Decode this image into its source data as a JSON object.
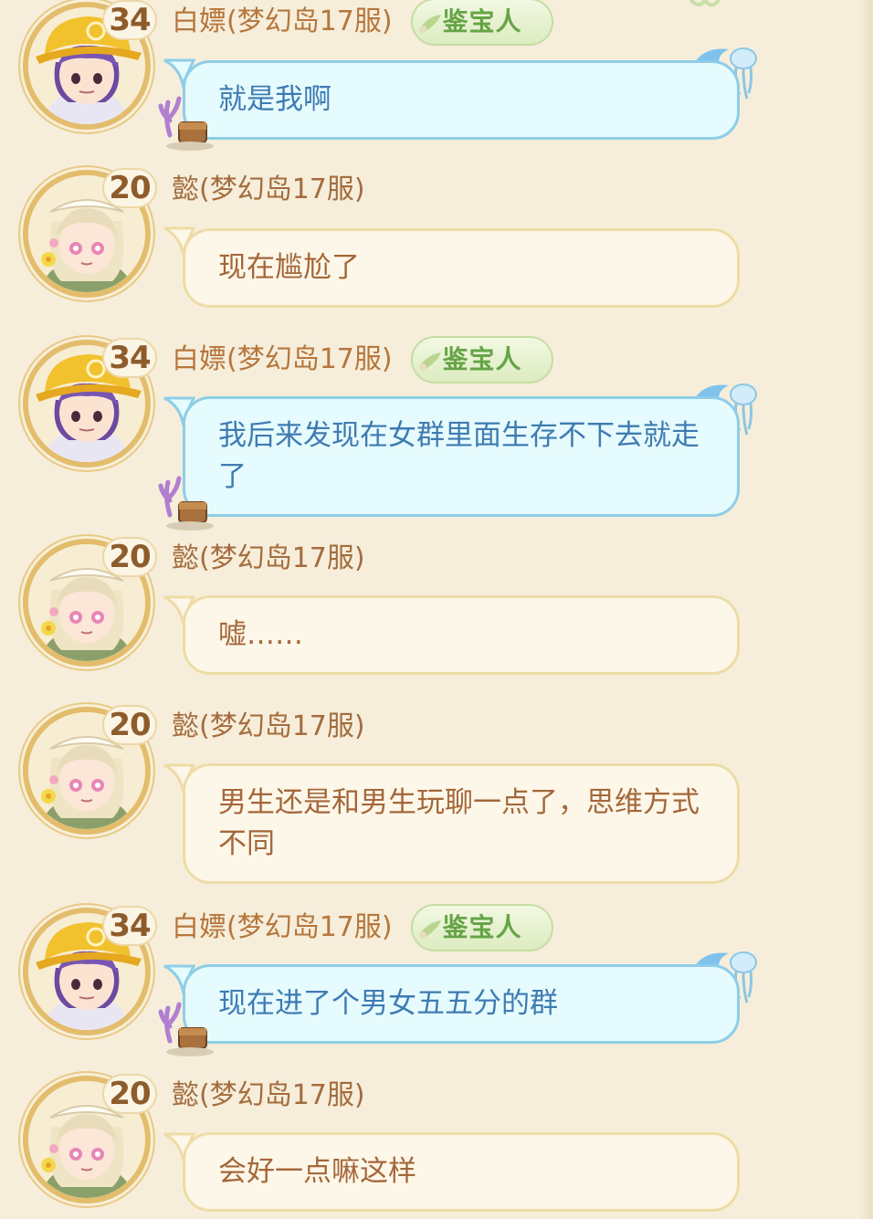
{
  "messages": [
    {
      "level": "34",
      "name": "白嫖(梦幻岛17服)",
      "badge": "鉴宝人",
      "text": "就是我啊",
      "style": "blue",
      "avatar": "hardhat-boy-avatar"
    },
    {
      "level": "20",
      "name": "懿(梦幻岛17服)",
      "badge": "",
      "text": "现在尴尬了",
      "style": "cream",
      "avatar": "maid-girl-avatar"
    },
    {
      "level": "34",
      "name": "白嫖(梦幻岛17服)",
      "badge": "鉴宝人",
      "text": "我后来发现在女群里面生存不下去就走了",
      "style": "blue",
      "avatar": "hardhat-boy-avatar"
    },
    {
      "level": "20",
      "name": "懿(梦幻岛17服)",
      "badge": "",
      "text": "嘘……",
      "style": "cream",
      "avatar": "maid-girl-avatar"
    },
    {
      "level": "20",
      "name": "懿(梦幻岛17服)",
      "badge": "",
      "text": "男生还是和男生玩聊一点了，思维方式不同",
      "style": "cream",
      "avatar": "maid-girl-avatar"
    },
    {
      "level": "34",
      "name": "白嫖(梦幻岛17服)",
      "badge": "鉴宝人",
      "text": "现在进了个男女五五分的群",
      "style": "blue",
      "avatar": "hardhat-boy-avatar"
    },
    {
      "level": "20",
      "name": "懿(梦幻岛17服)",
      "badge": "",
      "text": "会好一点嘛这样",
      "style": "cream",
      "avatar": "maid-girl-avatar"
    }
  ],
  "colors": {
    "background": "#f6eedb",
    "cream_bubble": "#fdf7e9",
    "blue_bubble": "#e6fbfd",
    "cream_text": "#a4673a",
    "blue_text": "#3e7bb3",
    "badge_green": "#66a447"
  }
}
